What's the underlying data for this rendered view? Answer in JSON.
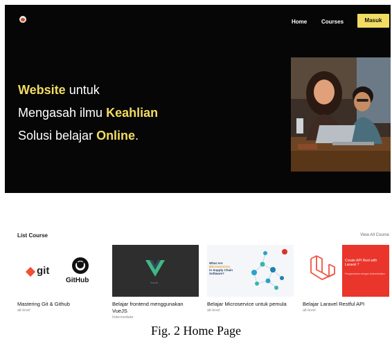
{
  "nav": {
    "home": "Home",
    "courses": "Courses",
    "login": "Masuk"
  },
  "hero": {
    "line1_accent": "Website",
    "line1_rest": " untuk",
    "line2_pre": "Mengasah ilmu ",
    "line2_accent": "Keahlian",
    "line3_pre": "Solusi belajar ",
    "line3_accent": "Online",
    "line3_post": ".",
    "accent_color": "#f2dc62"
  },
  "courses_section": {
    "title": "List Course",
    "view_all": "View All Course",
    "items": [
      {
        "title": "Mastering Git & Github",
        "level": "all-level",
        "thumb_text": [
          "git",
          "GitHub"
        ]
      },
      {
        "title": "Belajar frontend menggunakan VueJS",
        "level": "Intermediate",
        "thumb_text": [
          "VueJs"
        ]
      },
      {
        "title": "Belajar Microservice untuk pemula",
        "level": "all-level",
        "thumb_text": [
          "What Are",
          "Microservices",
          "in Supply Chain",
          "Software?"
        ]
      },
      {
        "title": "Belajar Laravel Restful API",
        "level": "all-level",
        "thumb_text": [
          "Create API Rest with Laravel 7",
          "Pengamankan dengan Authentication"
        ]
      }
    ]
  },
  "caption": "Fig. 2 Home Page"
}
